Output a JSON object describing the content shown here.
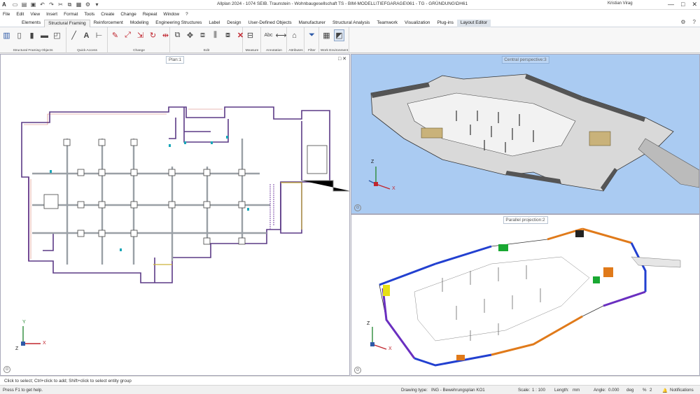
{
  "titlebar": {
    "logo": "A",
    "title": "Allplan 2024 - 1074 SEIB. Traunstein - Wohnbaugesellschaft TS - BIM-MODELL\\TIEFGARAGE\\061 - TG - GRÜNDUNG\\DH61",
    "user": "Kristian Virag",
    "qat_icons": [
      "new-icon",
      "open-icon",
      "save-icon",
      "undo-icon",
      "redo-icon",
      "cut-icon",
      "copy-icon",
      "paste-icon",
      "settings-icon",
      "more-icon"
    ]
  },
  "menu": [
    "File",
    "Edit",
    "View",
    "Insert",
    "Format",
    "Tools",
    "Create",
    "Change",
    "Repeat",
    "Window",
    "?"
  ],
  "tabs": [
    {
      "label": "Elements"
    },
    {
      "label": "Structural Framing",
      "active": true
    },
    {
      "label": "Reinforcement"
    },
    {
      "label": "Modeling"
    },
    {
      "label": "Engineering Structures"
    },
    {
      "label": "Label"
    },
    {
      "label": "Design"
    },
    {
      "label": "User-Defined Objects"
    },
    {
      "label": "Manufacturer"
    },
    {
      "label": "Structural Analysis"
    },
    {
      "label": "Teamwork"
    },
    {
      "label": "Visualization"
    },
    {
      "label": "Plug-ins"
    },
    {
      "label": "Layout Editor",
      "highlight": true
    }
  ],
  "ribbon": {
    "groups": [
      {
        "label": "Structural Framing Objects"
      },
      {
        "label": "Quick Access"
      },
      {
        "label": "Change"
      },
      {
        "label": "Edit"
      },
      {
        "label": "Measure"
      },
      {
        "label": "Annotation"
      },
      {
        "label": "Attributes"
      },
      {
        "label": "Filter"
      },
      {
        "label": "Work Environment"
      }
    ]
  },
  "viewports": {
    "plan": {
      "title": "Plan:1",
      "close": "□ ✕"
    },
    "central": {
      "title": "Central perspective:3"
    },
    "parallel": {
      "title": "Parallel projection:2"
    }
  },
  "axes": {
    "x": "X",
    "y": "Y",
    "z": "Z"
  },
  "status": {
    "message": "Click to select; Ctrl+click to add; Shift+click to select entity group",
    "help": "Press F1 to get help.",
    "drawing_type_label": "Drawing type:",
    "drawing_type_value": "ING - Bewehrungsplan KO1",
    "scale_label": "Scale:",
    "scale_value": "1 : 100",
    "length_label": "Length:",
    "length_value": "mm",
    "angle_label": "Angle:",
    "angle_value": "0.000",
    "angle_unit": "deg",
    "percent_label": "%",
    "percent_value": "2",
    "notifications": "Notifications"
  },
  "colors": {
    "plan_wall": "#6a3a8c",
    "accent_blue": "#2e5aa8",
    "perspective_bg": "#aacbf2"
  }
}
